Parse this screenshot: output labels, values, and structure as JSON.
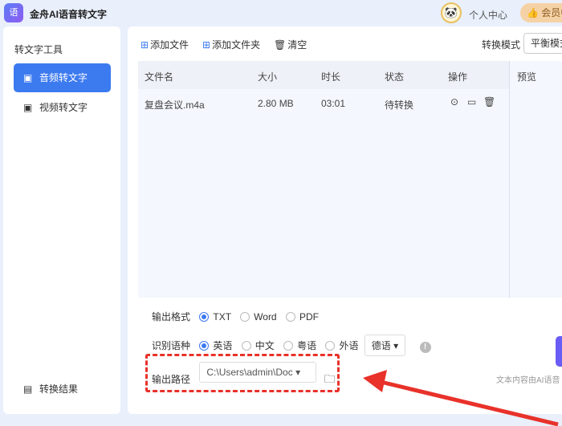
{
  "app": {
    "title": "金舟AI语音转文字",
    "logo_text": "语",
    "user_center": "个人中心",
    "vip": "会员中心"
  },
  "sidebar": {
    "heading": "转文字工具",
    "items": [
      {
        "label": "音频转文字",
        "icon": "audio-text-icon"
      },
      {
        "label": "视频转文字",
        "icon": "video-text-icon"
      }
    ],
    "result": "转换结果"
  },
  "toolbar": {
    "add_file": "添加文件",
    "add_folder": "添加文件夹",
    "clear": "清空",
    "mode_label": "转换模式",
    "mode_value": "平衡模式"
  },
  "table": {
    "headers": [
      "文件名",
      "大小",
      "时长",
      "状态",
      "操作"
    ],
    "rows": [
      {
        "name": "复盘会议.m4a",
        "size": "2.80 MB",
        "duration": "03:01",
        "status": "待转换"
      }
    ]
  },
  "preview": {
    "title": "预览"
  },
  "options": {
    "format_label": "输出格式",
    "formats": [
      "TXT",
      "Word",
      "PDF"
    ],
    "format_selected": "TXT",
    "lang_label": "识别语种",
    "langs": [
      "英语",
      "中文",
      "粤语",
      "外语"
    ],
    "lang_selected": "英语",
    "foreign_value": "德语",
    "path_label": "输出路径",
    "path_value": "C:\\Users\\admin\\Doc"
  },
  "note": "文本内容由AI语音",
  "colors": {
    "accent": "#3c7af0",
    "annotation": "#e8322a",
    "start": "#6a5cf6"
  }
}
